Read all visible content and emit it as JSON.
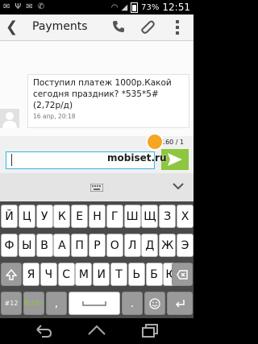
{
  "status_bar": {
    "battery_percent": "73%",
    "time": "12:51"
  },
  "header": {
    "contact_name": "Payments"
  },
  "message": {
    "text": "Поступил платеж 1000р.Какой\nсегодня праздник? *535*5#\n(2,72р/д)",
    "timestamp": "16 апр, 20:18"
  },
  "watermark": {
    "text": "mobiset.ru"
  },
  "composer": {
    "char_counter": "160 / 1",
    "input_value": ""
  },
  "keyboard": {
    "row1": [
      "Й",
      "Ц",
      "У",
      "К",
      "Е",
      "Н",
      "Г",
      "Ш",
      "Щ",
      "З",
      "Х"
    ],
    "row2": [
      "Ф",
      "Ы",
      "В",
      "А",
      "П",
      "Р",
      "О",
      "Л",
      "Д",
      "Ж",
      "Э"
    ],
    "row3": [
      "Я",
      "Ч",
      "С",
      "М",
      "И",
      "Т",
      "Ь",
      "Б",
      "Ю"
    ],
    "symbols_key": "#12",
    "lang_key": "RU/En",
    "comma_key": ",",
    "period_key": ".",
    "lang_key_color": "#8ec63f"
  },
  "colors": {
    "accent": "#33b5e5",
    "send": "#8ec63f"
  }
}
